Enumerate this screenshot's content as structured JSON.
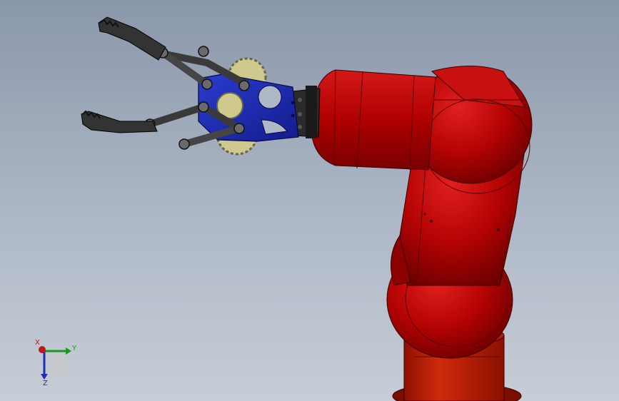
{
  "viewport": {
    "background_top": "#8a97aa",
    "background_bottom": "#c6cdd6"
  },
  "model": {
    "arm_color": "#b30000",
    "arm_highlight": "#e01818",
    "gripper_frame_color": "#1f2fb0",
    "gear_color": "#cfc98d",
    "finger_color": "#3a3a3a"
  },
  "triad": {
    "x_label": "X",
    "y_label": "Y",
    "z_label": "Z",
    "x_color": "#c01818",
    "y_color": "#1a9a1a",
    "z_color": "#1c2eb8"
  }
}
